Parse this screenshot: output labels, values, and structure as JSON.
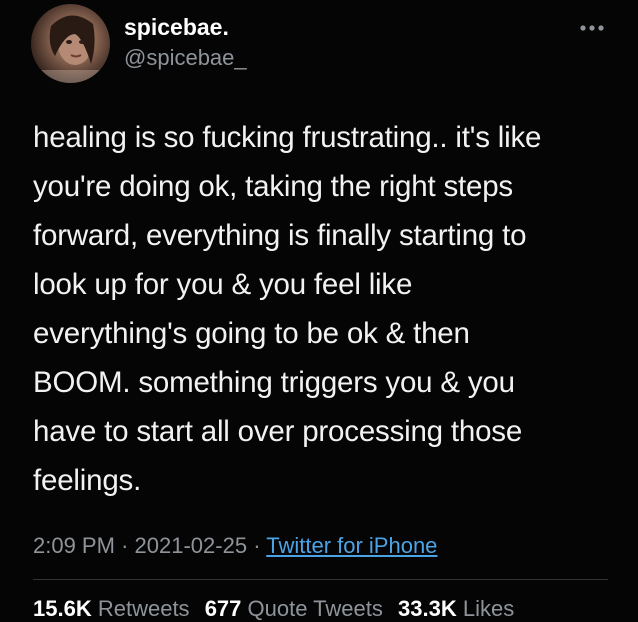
{
  "tweet": {
    "author": {
      "display_name": "spicebae.",
      "handle": "@spicebae_",
      "avatar_icon": "avatar-photo"
    },
    "more_icon": "more-horizontal-icon",
    "text_lines": [
      "healing is so fucking frustrating.. it's like",
      "you're doing ok, taking the right steps",
      "forward, everything is finally starting to",
      "look up for you & you feel like",
      "everything's going to be ok & then",
      "BOOM. something triggers you & you",
      "have to start all over processing those",
      "feelings."
    ],
    "time": "2:09 PM",
    "date": "2021-02-25",
    "separator": "·",
    "source": "Twitter for iPhone",
    "stats": {
      "retweets_count": "15.6K",
      "retweets_label": "Retweets",
      "quote_tweets_count": "677",
      "quote_tweets_label": "Quote Tweets",
      "likes_count": "33.3K",
      "likes_label": "Likes"
    }
  },
  "colors": {
    "background": "#050505",
    "text": "#f2f2f2",
    "secondary": "#8e9499",
    "link": "#4ba3e6"
  }
}
